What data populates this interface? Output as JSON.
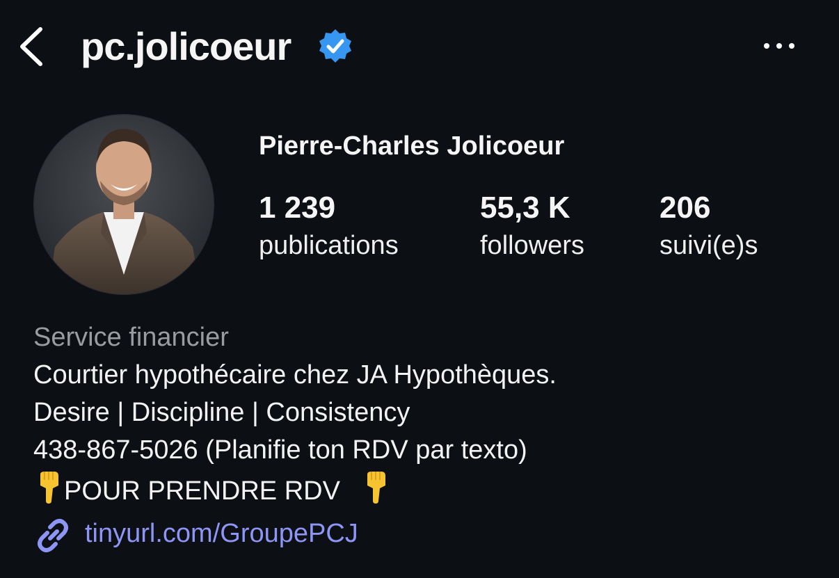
{
  "header": {
    "username": "pc.jolicoeur",
    "verified": true,
    "back_icon": "chevron-left-icon",
    "more_icon": "more-horizontal-icon"
  },
  "profile": {
    "display_name": "Pierre-Charles Jolicoeur",
    "stats": [
      {
        "value": "1 239",
        "label": "publications"
      },
      {
        "value": "55,3 K",
        "label": "followers"
      },
      {
        "value": "206",
        "label": "suivi(e)s"
      }
    ]
  },
  "bio": {
    "category": "Service financier",
    "line1": "Courtier hypothécaire chez JA Hypothèques.",
    "line2": "Desire | Discipline | Consistency",
    "line3": "438-867-5026 (Planifie ton RDV par texto)",
    "line4": "POUR PRENDRE RDV",
    "line4_emoji": "pointing-down-hand"
  },
  "link": {
    "text": "tinyurl.com/GroupePCJ",
    "icon": "link-icon"
  },
  "colors": {
    "background": "#0c0f14",
    "verified_badge": "#3797f0",
    "link": "#8d95f5",
    "muted_text": "#9a9ca2"
  }
}
